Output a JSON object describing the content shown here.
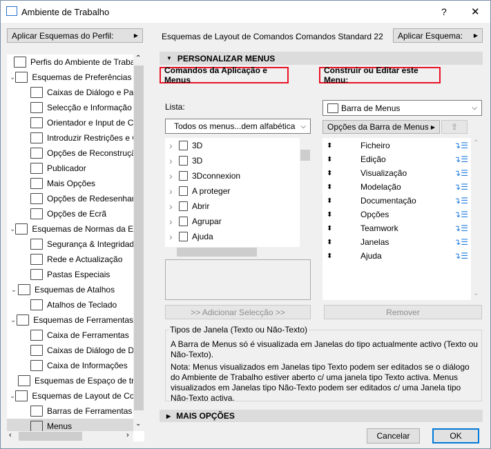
{
  "window": {
    "title": "Ambiente de Trabalho",
    "help": "?",
    "close": "✕"
  },
  "left": {
    "apply_profile_button": "Aplicar Esquemas do Perfil:",
    "tree": [
      {
        "label": "Perfis do Ambiente de Trabalho",
        "level": 0,
        "icon": "profile-icon"
      },
      {
        "label": "Esquemas de Preferências do Utilizador",
        "level": 0,
        "expanded": true,
        "icon": "user-scheme-icon"
      },
      {
        "label": "Caixas de Diálogo e Paletas",
        "level": 1,
        "icon": "dialog-icon"
      },
      {
        "label": "Selecção e Informação de Elementos",
        "level": 1,
        "icon": "selection-icon"
      },
      {
        "label": "Orientador e Input de Coordenadas",
        "level": 1,
        "icon": "xyz-icon"
      },
      {
        "label": "Introduzir Restrições e Guias",
        "level": 1,
        "icon": "mouse-icon"
      },
      {
        "label": "Opções de Reconstrução",
        "level": 1,
        "icon": "wall-icon"
      },
      {
        "label": "Publicador",
        "level": 1,
        "icon": "publisher-icon"
      },
      {
        "label": "Mais Opções",
        "level": 1,
        "icon": "sliders-icon"
      },
      {
        "label": "Opções de Redesenhar A",
        "level": 1,
        "icon": "house-icon"
      },
      {
        "label": "Opções de Ecrã",
        "level": 1,
        "icon": "monitor-icon"
      },
      {
        "label": "Esquemas de Normas da Empresa",
        "level": 0,
        "expanded": true,
        "icon": "company-scheme-icon"
      },
      {
        "label": "Segurança & Integridade",
        "level": 1,
        "icon": "security-icon"
      },
      {
        "label": "Rede e Actualização",
        "level": 1,
        "icon": "globe-icon"
      },
      {
        "label": "Pastas Especiais",
        "level": 1,
        "icon": "folder-icon"
      },
      {
        "label": "Esquemas de Atalhos",
        "level": 0,
        "expanded": true,
        "icon": "shortcut-scheme-icon"
      },
      {
        "label": "Atalhos de Teclado",
        "level": 1,
        "icon": "shortcut-icon"
      },
      {
        "label": "Esquemas de Ferramentas",
        "level": 0,
        "expanded": true,
        "icon": "tool-scheme-icon"
      },
      {
        "label": "Caixa de Ferramentas",
        "level": 1,
        "icon": "toolbox-icon"
      },
      {
        "label": "Caixas de Diálogo de Definições",
        "level": 1,
        "icon": "tool-dialog-icon"
      },
      {
        "label": "Caixa de Informações",
        "level": 1,
        "icon": "info-box-icon"
      },
      {
        "label": "Esquemas de Espaço de trabalho",
        "level": 0,
        "icon": "workspace-scheme-icon"
      },
      {
        "label": "Esquemas de Layout de Comandos",
        "level": 0,
        "expanded": true,
        "icon": "layout-scheme-icon"
      },
      {
        "label": "Barras de Ferramentas",
        "level": 1,
        "icon": "toolbar-icon"
      },
      {
        "label": "Menus",
        "level": 1,
        "selected": true,
        "icon": "menu-icon"
      }
    ]
  },
  "right": {
    "scheme_label": "Esquemas de Layout de Comandos :",
    "scheme_value": "Comandos Standard 22",
    "apply_scheme_button": "Aplicar Esquema:",
    "section_title": "PERSONALIZAR MENUS",
    "left_heading": "Comandos da Aplicação e Menus",
    "right_heading": "Construir ou Editar este Menu:",
    "list_label": "Lista:",
    "list_select": "Todos os menus...dem alfabética",
    "commands": [
      "3D",
      "3D",
      "3Dconnexion",
      "A proteger",
      "Abrir",
      "Agrupar",
      "Ajuda"
    ],
    "add_button": ">> Adicionar Selecção >>",
    "menu_select": "Barra de Menus",
    "menubar_options_button": "Opções da Barra de Menus",
    "menu_items": [
      "Ficheiro",
      "Edição",
      "Visualização",
      "Modelação",
      "Documentação",
      "Opções",
      "Teamwork",
      "Janelas",
      "Ajuda"
    ],
    "remove_button": "Remover",
    "group_title": "Tipos de Janela (Texto ou Não-Texto)",
    "info1": "A Barra de Menus só é visualizada em Janelas do tipo actualmente activo (Texto ou Não-Texto).",
    "info2": "Nota: Menus visualizados em Janelas tipo Texto podem ser editados se o diálogo do Ambiente de Trabalho estiver aberto c/ uma janela tipo Texto activa. Menus visualizados em Janelas tipo Não-Texto podem ser editados c/ uma Janela tipo Não-Texto activa.",
    "more_options": "MAIS OPÇÕES"
  },
  "footer": {
    "cancel": "Cancelar",
    "ok": "OK"
  }
}
